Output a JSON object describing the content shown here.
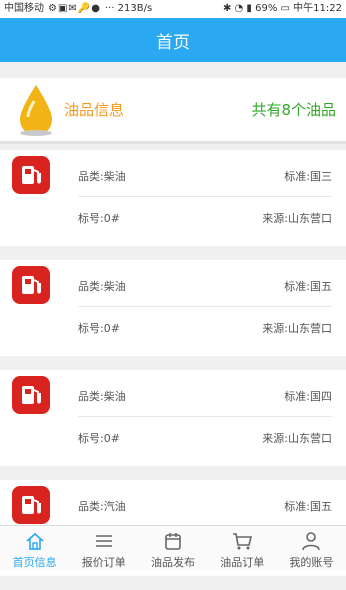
{
  "status_bar": {
    "carrier": "中国移动",
    "speed": "··· 213B/s",
    "battery": "69%",
    "time": "中午11:22"
  },
  "header": {
    "title": "首页"
  },
  "info": {
    "title": "油品信息",
    "count": "共有8个油品"
  },
  "products": [
    {
      "category": "品类:柴油",
      "standard": "标准:国三",
      "grade": "标号:0#",
      "source": "来源:山东营口"
    },
    {
      "category": "品类:柴油",
      "standard": "标准:国五",
      "grade": "标号:0#",
      "source": "来源:山东营口"
    },
    {
      "category": "品类:柴油",
      "standard": "标准:国四",
      "grade": "标号:0#",
      "source": "来源:山东营口"
    },
    {
      "category": "品类:汽油",
      "standard": "标准:国五",
      "grade": "",
      "source": ""
    }
  ],
  "tabs": [
    {
      "label": "首页信息",
      "icon": "home-icon",
      "active": true
    },
    {
      "label": "报价订单",
      "icon": "list-icon"
    },
    {
      "label": "油品发布",
      "icon": "calendar-icon"
    },
    {
      "label": "油品订单",
      "icon": "cart-icon"
    },
    {
      "label": "我的账号",
      "icon": "user-icon"
    }
  ],
  "colors": {
    "accent": "#2aa8f2",
    "pump": "#d9231f",
    "info_title": "#f39a1c",
    "count": "#35a62c"
  }
}
